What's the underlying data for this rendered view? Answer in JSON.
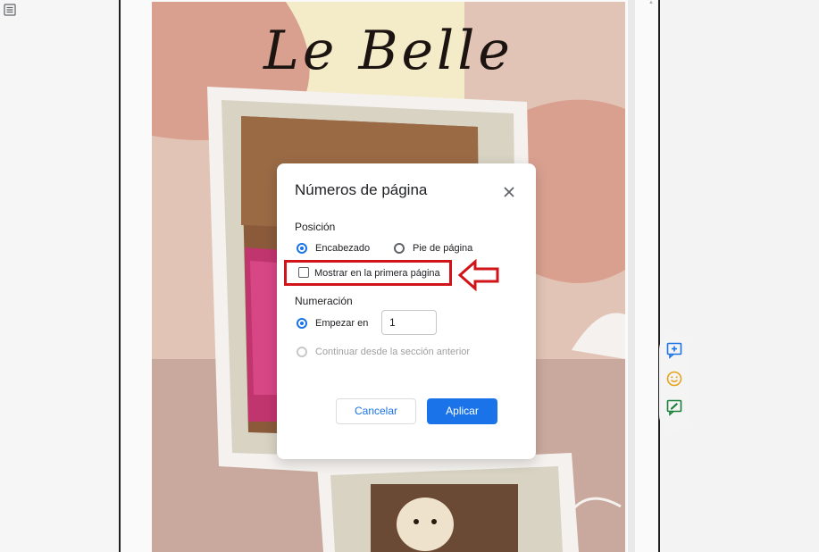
{
  "document": {
    "cover_title": "Le Belle"
  },
  "dialog": {
    "title": "Números de página",
    "position_label": "Posición",
    "header_option": "Encabezado",
    "footer_option": "Pie de página",
    "selected_position": "Encabezado",
    "first_page_label": "Mostrar en la primera página",
    "first_page_checked": false,
    "numbering_label": "Numeración",
    "start_at_label": "Empezar en",
    "start_at_value": "1",
    "continue_label": "Continuar desde la sección anterior",
    "cancel_label": "Cancelar",
    "apply_label": "Aplicar"
  },
  "colors": {
    "accent": "#1a73e8",
    "annotation": "#d0141a"
  },
  "side_tools": [
    "add-comment-icon",
    "emoji-icon",
    "suggest-edit-icon"
  ]
}
